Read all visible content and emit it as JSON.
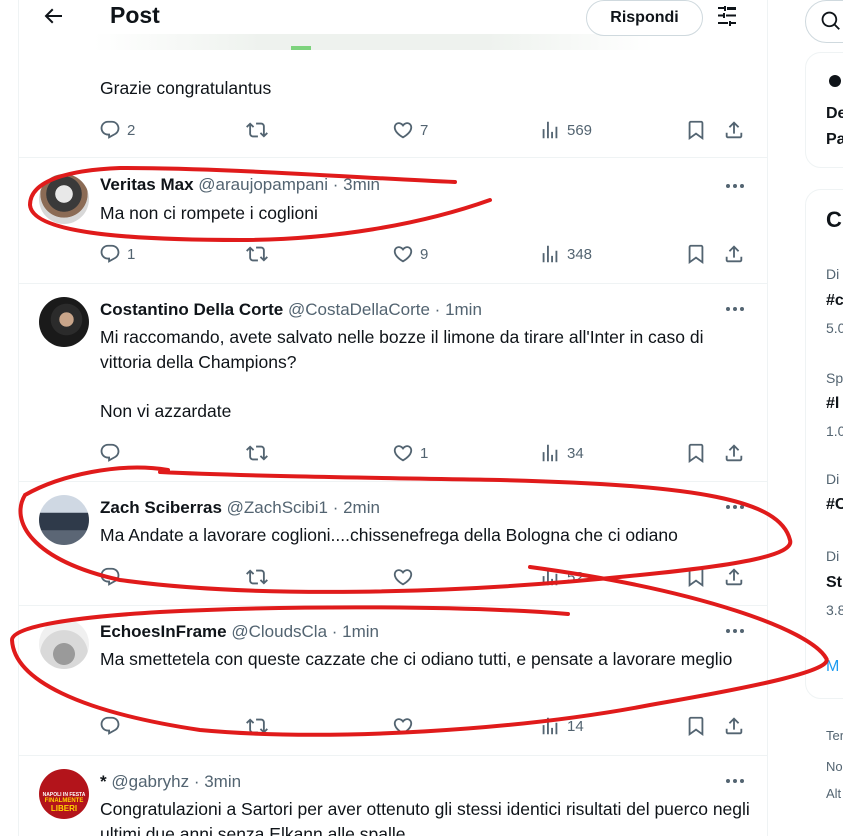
{
  "header": {
    "title": "Post",
    "reply_label": "Rispondi"
  },
  "main_tweet": {
    "text": "Grazie congratulantus",
    "replies": "2",
    "retweets": "",
    "likes": "7",
    "views": "569"
  },
  "replies": [
    {
      "name": "Veritas Max",
      "handle": "@araujopampani · 3min",
      "text": "Ma non ci rompete i coglioni",
      "replies": "1",
      "retweets": "",
      "likes": "9",
      "views": "348"
    },
    {
      "name": "Costantino Della Corte",
      "handle": "@CostaDellaCorte · 1min",
      "text": "Mi raccomando, avete salvato nelle bozze il limone da tirare all'Inter in caso di vittoria della Champions?\n\nNon vi azzardate",
      "replies": "",
      "retweets": "",
      "likes": "1",
      "views": "34"
    },
    {
      "name": "Zach Sciberras",
      "handle": "@ZachScibi1 · 2min",
      "text": "Ma Andate a lavorare coglioni....chissenefrega della Bologna che ci odiano",
      "replies": "",
      "retweets": "",
      "likes": "",
      "views": "52"
    },
    {
      "name": "EchoesInFrame",
      "handle": "@CloudsCla · 1min",
      "text": "Ma smettetela con queste cazzate che ci odiano tutti, e pensate a lavorare meglio",
      "replies": "",
      "retweets": "",
      "likes": "",
      "views": "14"
    },
    {
      "name": "*",
      "handle": "@gabryhz · 3min",
      "text": "Congratulazioni a Sartori per aver ottenuto gli stessi identici risultati del puerco negli ultimi due anni senza Elkann alle spalle"
    }
  ],
  "avatar_badge": {
    "line1": "NAPOLI IN FESTA",
    "line2": "FINALMENTE",
    "line3": "LIBERI"
  },
  "sidebar": {
    "card1": [
      "De",
      "Pa"
    ],
    "card2_title": "C",
    "trends": [
      {
        "cat": "Di",
        "tag": "#c",
        "count": "5.0"
      },
      {
        "cat": "Sp",
        "tag": "#l",
        "count": "1.0"
      },
      {
        "cat": "Di",
        "tag": "#C",
        "count": ""
      },
      {
        "cat": "Di",
        "tag": "St",
        "count": "3.8"
      }
    ],
    "more": "M",
    "footer": [
      "Ter",
      "No",
      "Alt"
    ]
  },
  "colors": {
    "secondary_text": "#536471",
    "border": "#eff3f4",
    "annotation": "#e01b1b",
    "link": "#1d9bf0"
  }
}
